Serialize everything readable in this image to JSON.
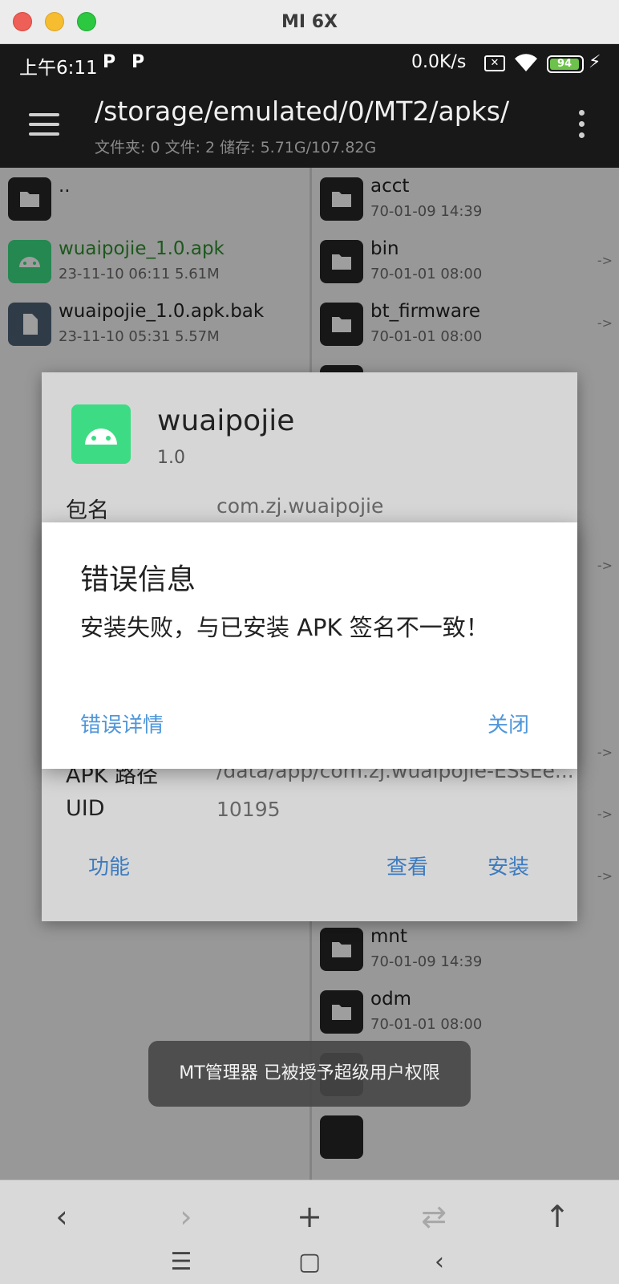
{
  "window": {
    "title": "MI 6X"
  },
  "status_bar": {
    "time": "上午6:11",
    "indicator_1": "P",
    "indicator_2": "P",
    "net_speed": "0.0K/s",
    "battery": "94"
  },
  "app_bar": {
    "path": "/storage/emulated/0/MT2/apks/",
    "summary": "文件夹: 0  文件: 2  储存: 5.71G/107.82G"
  },
  "left_pane": {
    "items": [
      {
        "name": "..",
        "meta": "",
        "icon": "folder-icon"
      },
      {
        "name": "wuaipojie_1.0.apk",
        "meta": "23-11-10 06:11  5.61M",
        "icon": "android-icon"
      },
      {
        "name": "wuaipojie_1.0.apk.bak",
        "meta": "23-11-10 05:31  5.57M",
        "icon": "file-icon"
      }
    ]
  },
  "right_pane": {
    "items": [
      {
        "name": "acct",
        "meta": "70-01-09 14:39",
        "arrow": ""
      },
      {
        "name": "bin",
        "meta": "70-01-01 08:00",
        "arrow": "->"
      },
      {
        "name": "bt_firmware",
        "meta": "70-01-01 08:00",
        "arrow": "->"
      },
      {
        "name": "mnt",
        "meta": "70-01-09 14:39",
        "arrow": ""
      },
      {
        "name": "odm",
        "meta": "70-01-01 08:00",
        "arrow": ""
      }
    ],
    "hidden_row_arrows": [
      "->",
      "->",
      "->",
      "->"
    ]
  },
  "apk_dialog": {
    "app_name": "wuaipojie",
    "version": "1.0",
    "package_label": "包名",
    "package_value": "com.zj.wuaipojie",
    "apk_path_label": "APK 路径",
    "apk_path_value": "/data/app/com.zj.wuaipojie-ESsEe...",
    "uid_label": "UID",
    "uid_value": "10195",
    "function_button": "功能",
    "view_button": "查看",
    "install_button": "安装"
  },
  "error_dialog": {
    "title": "错误信息",
    "message": "安装失败，与已安装 APK 签名不一致！",
    "details_button": "错误详情",
    "close_button": "关闭"
  },
  "toast": {
    "text": "MT管理器 已被授予超级用户权限"
  },
  "toolbar": {
    "back": "‹",
    "forward": "›",
    "add": "+",
    "swap": "⇄",
    "up": "↑"
  },
  "nav_bar": {
    "menu": "☰",
    "home": "▢",
    "back": "‹"
  }
}
